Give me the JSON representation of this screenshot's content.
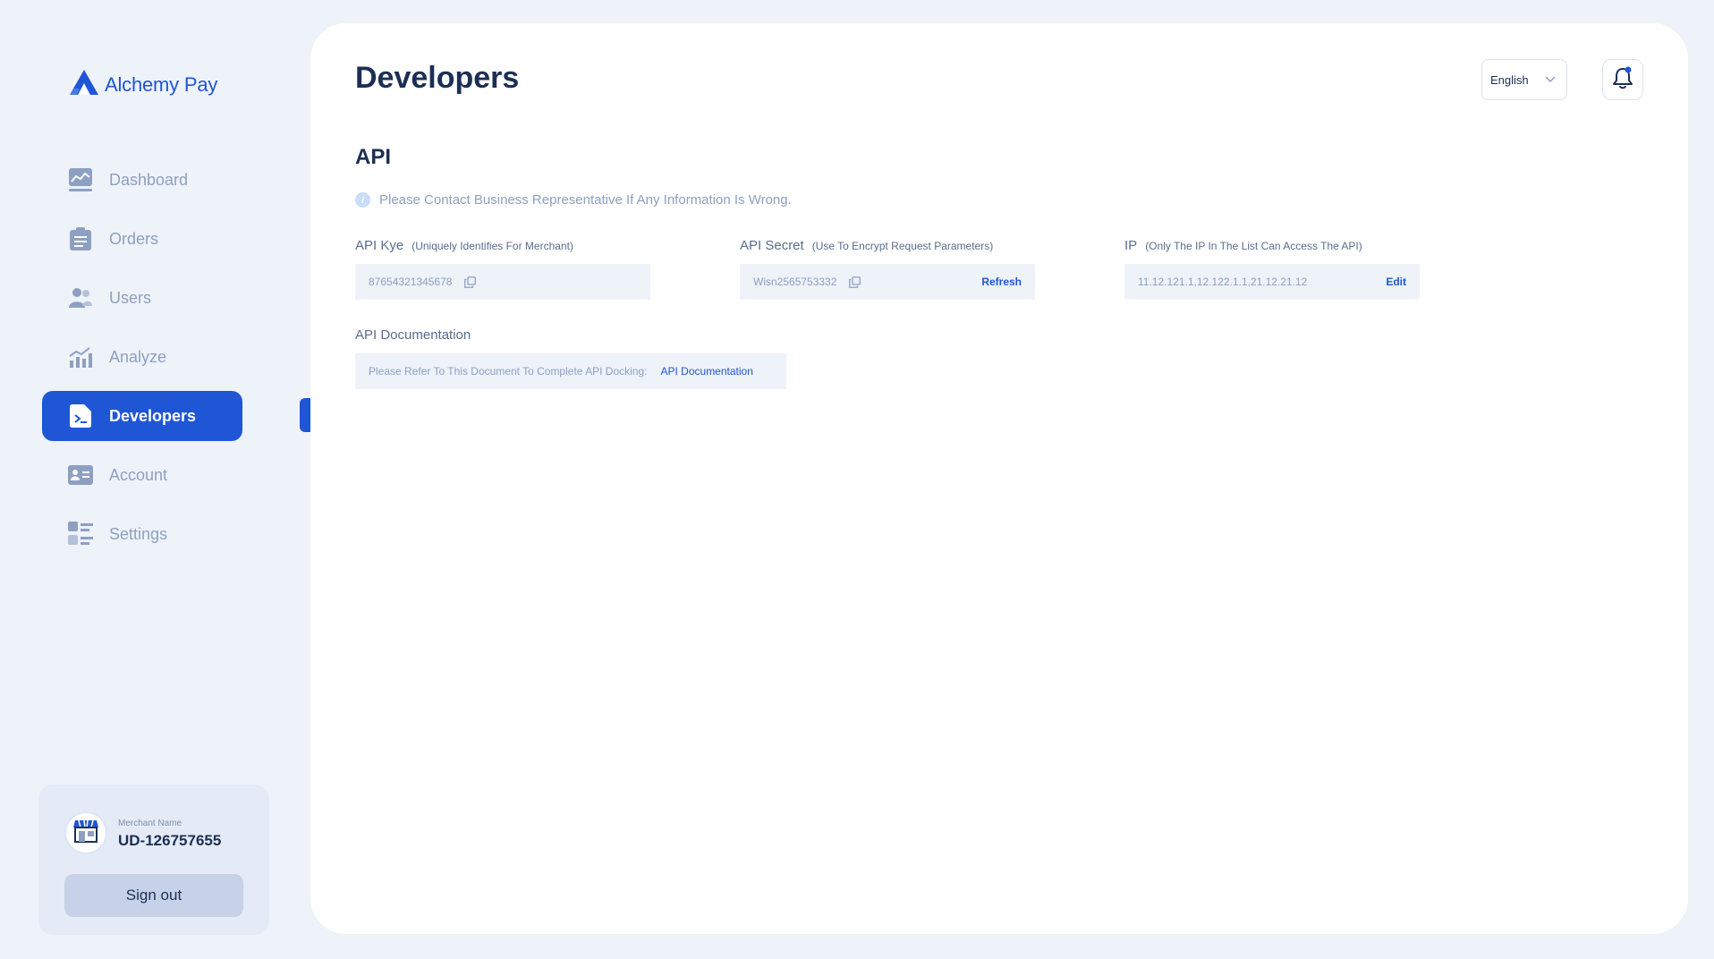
{
  "brand": {
    "name": "Alchemy Pay"
  },
  "sidebar": {
    "items": [
      {
        "label": "Dashboard",
        "icon": "dashboard-chart-icon"
      },
      {
        "label": "Orders",
        "icon": "clipboard-icon"
      },
      {
        "label": "Users",
        "icon": "users-icon"
      },
      {
        "label": "Analyze",
        "icon": "bar-chart-icon"
      },
      {
        "label": "Developers",
        "icon": "terminal-doc-icon",
        "active": true
      },
      {
        "label": "Account",
        "icon": "id-card-icon"
      },
      {
        "label": "Settings",
        "icon": "settings-list-icon"
      }
    ]
  },
  "merchant": {
    "caption": "Merchant Name",
    "name": "UD-126757655",
    "signout_label": "Sign out"
  },
  "header": {
    "title": "Developers",
    "language": "English"
  },
  "api": {
    "section_title": "API",
    "notice": "Please Contact Business Representative If Any Information Is Wrong.",
    "key": {
      "label": "API Kye",
      "hint": "(Uniquely Identifies For Merchant)",
      "value": "87654321345678"
    },
    "secret": {
      "label": "API Secret",
      "hint": "(Use To Encrypt Request Parameters)",
      "value": "Wisn2565753332",
      "action": "Refresh"
    },
    "ip": {
      "label": "IP",
      "hint": "(Only The IP In The List Can Access The API)",
      "value": "11.12.121.1,12.122.1.1,21.12.21.12",
      "action": "Edit"
    },
    "docs": {
      "label": "API Documentation",
      "text": "Please Refer To This Document To Complete API Docking:",
      "link": "API Documentation"
    }
  },
  "colors": {
    "accent": "#1f56d6",
    "background": "#eef2f9",
    "text_dark": "#1c2f55",
    "text_muted": "#8ea0c2"
  }
}
